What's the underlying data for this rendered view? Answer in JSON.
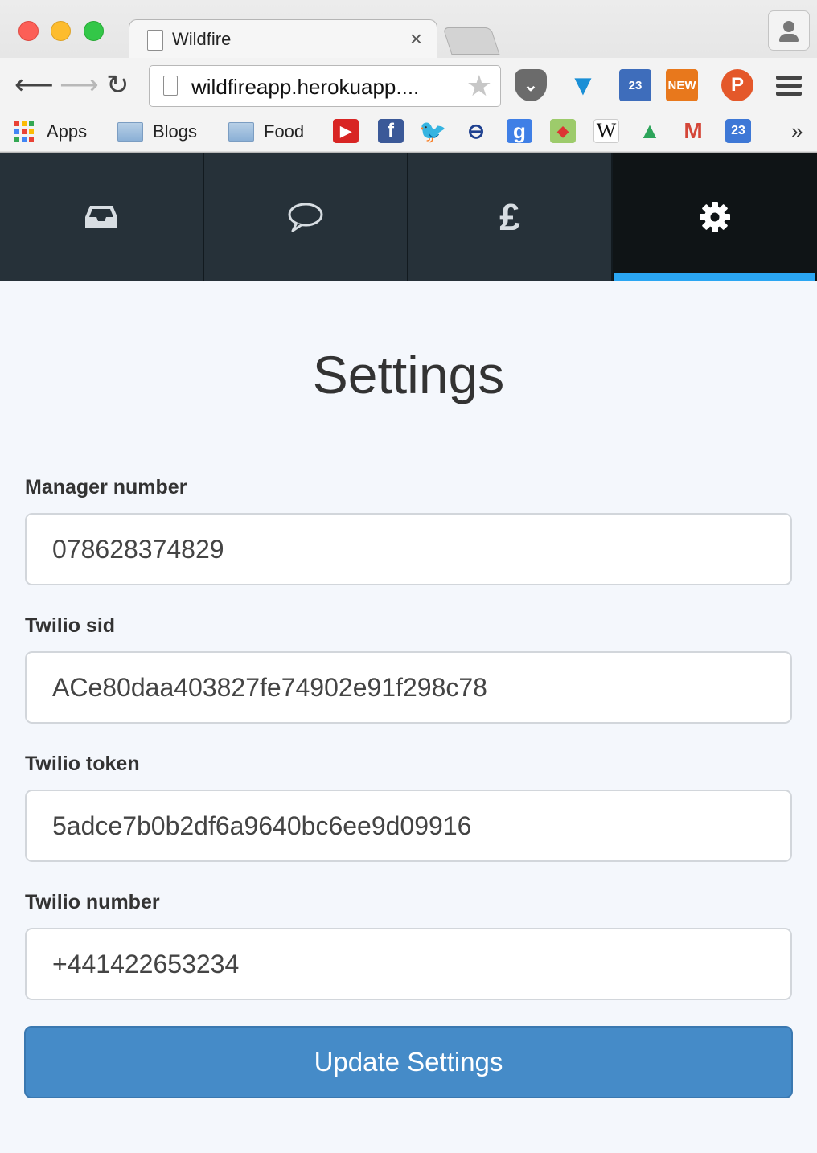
{
  "browser": {
    "tab_title": "Wildfire",
    "tab_close": "×",
    "url": "wildfireapp.herokuapp....",
    "extensions": {
      "pocket": "⌄",
      "funnel": "▼",
      "tree_badge": "23",
      "new_badge": "NEW",
      "p_badge": "P"
    },
    "bookmarks": {
      "apps": "Apps",
      "blogs": "Blogs",
      "food": "Food",
      "more": "»",
      "calendar_day": "23",
      "wikipedia": "W",
      "google": "g",
      "facebook": "f"
    }
  },
  "app_nav": {
    "tabs": [
      {
        "name": "inbox",
        "icon": "inbox-icon"
      },
      {
        "name": "messages",
        "icon": "chat-bubble-icon"
      },
      {
        "name": "billing",
        "icon": "pound-icon",
        "glyph": "£"
      },
      {
        "name": "settings",
        "icon": "gear-icon",
        "active": true
      }
    ],
    "active_color": "#2aa6f3"
  },
  "settings": {
    "title": "Settings",
    "fields": {
      "manager_number": {
        "label": "Manager number",
        "value": "078628374829"
      },
      "twilio_sid": {
        "label": "Twilio sid",
        "value": "ACe80daa403827fe74902e91f298c78"
      },
      "twilio_token": {
        "label": "Twilio token",
        "value": "5adce7b0b2df6a9640bc6ee9d09916"
      },
      "twilio_number": {
        "label": "Twilio number",
        "value": "+441422653234"
      }
    },
    "submit_label": "Update Settings",
    "button_color": "#458bc8"
  }
}
